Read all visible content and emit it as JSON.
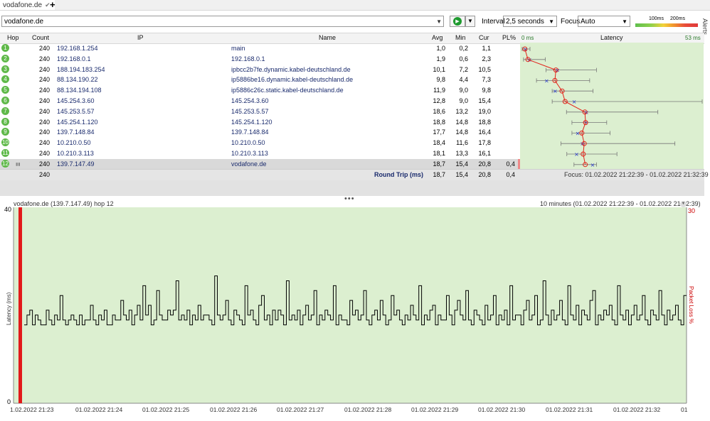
{
  "tab": {
    "title": "vodafone.de",
    "new_tab": "+"
  },
  "toolbar": {
    "target": "vodafone.de",
    "interval_label": "Interval",
    "interval_value": "2,5 seconds",
    "focus_label": "Focus",
    "focus_value": "Auto",
    "legend_100": "100ms",
    "legend_200": "200ms",
    "alerts_label": "Alerts"
  },
  "table": {
    "headers": {
      "hop": "Hop",
      "count": "Count",
      "ip": "IP",
      "name": "Name",
      "avg": "Avg",
      "min": "Min",
      "cur": "Cur",
      "pl": "PL%",
      "latency_min": "0 ms",
      "latency": "Latency",
      "latency_max": "53 ms"
    },
    "rows": [
      {
        "hop": "1",
        "count": "240",
        "ip": "192.168.1.254",
        "name": "main",
        "avg": "1,0",
        "min": "0,2",
        "cur": "1,1",
        "pl": ""
      },
      {
        "hop": "2",
        "count": "240",
        "ip": "192.168.0.1",
        "name": "192.168.0.1",
        "avg": "1,9",
        "min": "0,6",
        "cur": "2,3",
        "pl": ""
      },
      {
        "hop": "3",
        "count": "240",
        "ip": "188.194.183.254",
        "name": "ipbcc2b7fe.dynamic.kabel-deutschland.de",
        "avg": "10,1",
        "min": "7,2",
        "cur": "10,5",
        "pl": ""
      },
      {
        "hop": "4",
        "count": "240",
        "ip": "88.134.190.22",
        "name": "ip5886be16.dynamic.kabel-deutschland.de",
        "avg": "9,8",
        "min": "4,4",
        "cur": "7,3",
        "pl": ""
      },
      {
        "hop": "5",
        "count": "240",
        "ip": "88.134.194.108",
        "name": "ip5886c26c.static.kabel-deutschland.de",
        "avg": "11,9",
        "min": "9,0",
        "cur": "9,8",
        "pl": ""
      },
      {
        "hop": "6",
        "count": "240",
        "ip": "145.254.3.60",
        "name": "145.254.3.60",
        "avg": "12,8",
        "min": "9,0",
        "cur": "15,4",
        "pl": ""
      },
      {
        "hop": "7",
        "count": "240",
        "ip": "145.253.5.57",
        "name": "145.253.5.57",
        "avg": "18,6",
        "min": "13,2",
        "cur": "19,0",
        "pl": ""
      },
      {
        "hop": "8",
        "count": "240",
        "ip": "145.254.1.120",
        "name": "145.254.1.120",
        "avg": "18,8",
        "min": "14,8",
        "cur": "18,8",
        "pl": ""
      },
      {
        "hop": "9",
        "count": "240",
        "ip": "139.7.148.84",
        "name": "139.7.148.84",
        "avg": "17,7",
        "min": "14,8",
        "cur": "16,4",
        "pl": ""
      },
      {
        "hop": "10",
        "count": "240",
        "ip": "10.210.0.50",
        "name": "10.210.0.50",
        "avg": "18,4",
        "min": "11,6",
        "cur": "17,8",
        "pl": ""
      },
      {
        "hop": "11",
        "count": "240",
        "ip": "10.210.3.113",
        "name": "10.210.3.113",
        "avg": "18,1",
        "min": "13,3",
        "cur": "16,1",
        "pl": ""
      },
      {
        "hop": "12",
        "count": "240",
        "ip": "139.7.147.49",
        "name": "vodafone.de",
        "avg": "18,7",
        "min": "15,4",
        "cur": "20,8",
        "pl": "0,4"
      }
    ],
    "footer": {
      "count": "240",
      "label": "Round Trip (ms)",
      "avg": "18,7",
      "min": "15,4",
      "cur": "20,8",
      "pl": "0,4",
      "focus": "Focus: 01.02.2022 21:22:39 - 01.02.2022 21:32:39"
    }
  },
  "latency_plot": {
    "min_ms": 0,
    "max_ms": 53,
    "hops": [
      {
        "avg": 1.0,
        "min": 0.2,
        "cur": 1.1,
        "max": 2.5
      },
      {
        "avg": 1.9,
        "min": 0.6,
        "cur": 2.3,
        "max": 7
      },
      {
        "avg": 10.1,
        "min": 7.2,
        "cur": 10.5,
        "max": 22
      },
      {
        "avg": 9.8,
        "min": 4.4,
        "cur": 7.3,
        "max": 20
      },
      {
        "avg": 11.9,
        "min": 9.0,
        "cur": 9.8,
        "max": 21
      },
      {
        "avg": 12.8,
        "min": 9.0,
        "cur": 15.4,
        "max": 53
      },
      {
        "avg": 18.6,
        "min": 13.2,
        "cur": 19.0,
        "max": 40
      },
      {
        "avg": 18.8,
        "min": 14.8,
        "cur": 18.8,
        "max": 25
      },
      {
        "avg": 17.7,
        "min": 14.8,
        "cur": 16.4,
        "max": 26
      },
      {
        "avg": 18.4,
        "min": 11.6,
        "cur": 17.8,
        "max": 45
      },
      {
        "avg": 18.1,
        "min": 13.3,
        "cur": 16.1,
        "max": 28
      },
      {
        "avg": 18.7,
        "min": 15.4,
        "cur": 20.8,
        "max": 22
      }
    ]
  },
  "bottom_chart": {
    "title": "vodafone.de (139.7.147.49) hop 12",
    "range": "10 minutes (01.02.2022 21:22:39 - 01.02.2022 21:32:39)",
    "ylabel": "Latency (ms)",
    "y2label": "Packet Loss %",
    "y_top": "40",
    "y_bottom": "0",
    "y2_top": "30",
    "x_labels": [
      "1.02.2022 21:23",
      "01.02.2022 21:24",
      "01.02.2022 21:25",
      "01.02.2022 21:26",
      "01.02.2022 21:27",
      "01.02.2022 21:28",
      "01.02.2022 21:29",
      "01.02.2022 21:30",
      "01.02.2022 21:31",
      "01.02.2022 21:32",
      "01"
    ],
    "last_x_label": "01"
  },
  "chart_data": {
    "type": "line",
    "title": "vodafone.de (139.7.147.49) hop 12",
    "xlabel": "",
    "ylabel": "Latency (ms)",
    "y2label": "Packet Loss %",
    "ylim": [
      0,
      40
    ],
    "y2lim": [
      0,
      30
    ],
    "samples": 240,
    "series": [
      {
        "values": [
          16,
          18,
          19,
          16,
          18,
          17,
          16,
          16,
          19,
          17,
          16,
          18,
          17,
          22,
          17,
          16,
          17,
          18,
          17,
          16,
          18,
          16,
          17,
          17,
          20,
          17,
          16,
          18,
          17,
          19,
          16,
          16,
          18,
          17,
          17,
          21,
          18,
          17,
          19,
          16,
          18,
          20,
          17,
          24,
          18,
          20,
          16,
          17,
          23,
          18,
          17,
          17,
          19,
          18,
          19,
          25,
          17,
          18,
          17,
          19,
          16,
          18,
          17,
          20,
          17,
          18,
          18,
          17,
          16,
          26,
          18,
          17,
          18,
          21,
          17,
          16,
          19,
          18,
          17,
          16,
          24,
          18,
          19,
          17,
          16,
          20,
          22,
          17,
          18,
          16,
          19,
          17,
          19,
          18,
          16,
          25,
          17,
          18,
          17,
          19,
          16,
          18,
          20,
          17,
          18,
          23,
          16,
          18,
          17,
          19,
          18,
          17,
          24,
          16,
          18,
          17,
          17,
          16,
          21,
          18,
          19,
          17,
          18,
          23,
          17,
          16,
          18,
          19,
          17,
          21,
          18,
          16,
          17,
          22,
          18,
          19,
          17,
          16,
          18,
          17,
          20,
          18,
          17,
          24,
          16,
          18,
          17,
          19,
          20,
          16,
          18,
          17,
          17,
          22,
          18,
          16,
          19,
          21,
          18,
          17,
          23,
          17,
          16,
          19,
          18,
          17,
          16,
          20,
          17,
          18,
          22,
          16,
          18,
          17,
          19,
          16,
          24,
          17,
          18,
          18,
          16,
          19,
          21,
          17,
          18,
          22,
          16,
          17,
          25,
          18,
          16,
          19,
          17,
          18,
          21,
          17,
          16,
          24,
          18,
          17,
          20,
          16,
          19,
          18,
          17,
          21,
          23,
          16,
          18,
          17,
          19,
          18,
          20,
          17,
          16,
          24,
          18,
          17,
          19,
          16,
          18,
          20,
          17,
          18,
          22,
          17,
          16,
          19,
          18,
          17,
          23,
          18,
          16,
          19,
          17,
          18,
          20,
          17,
          16,
          22
        ]
      }
    ]
  }
}
